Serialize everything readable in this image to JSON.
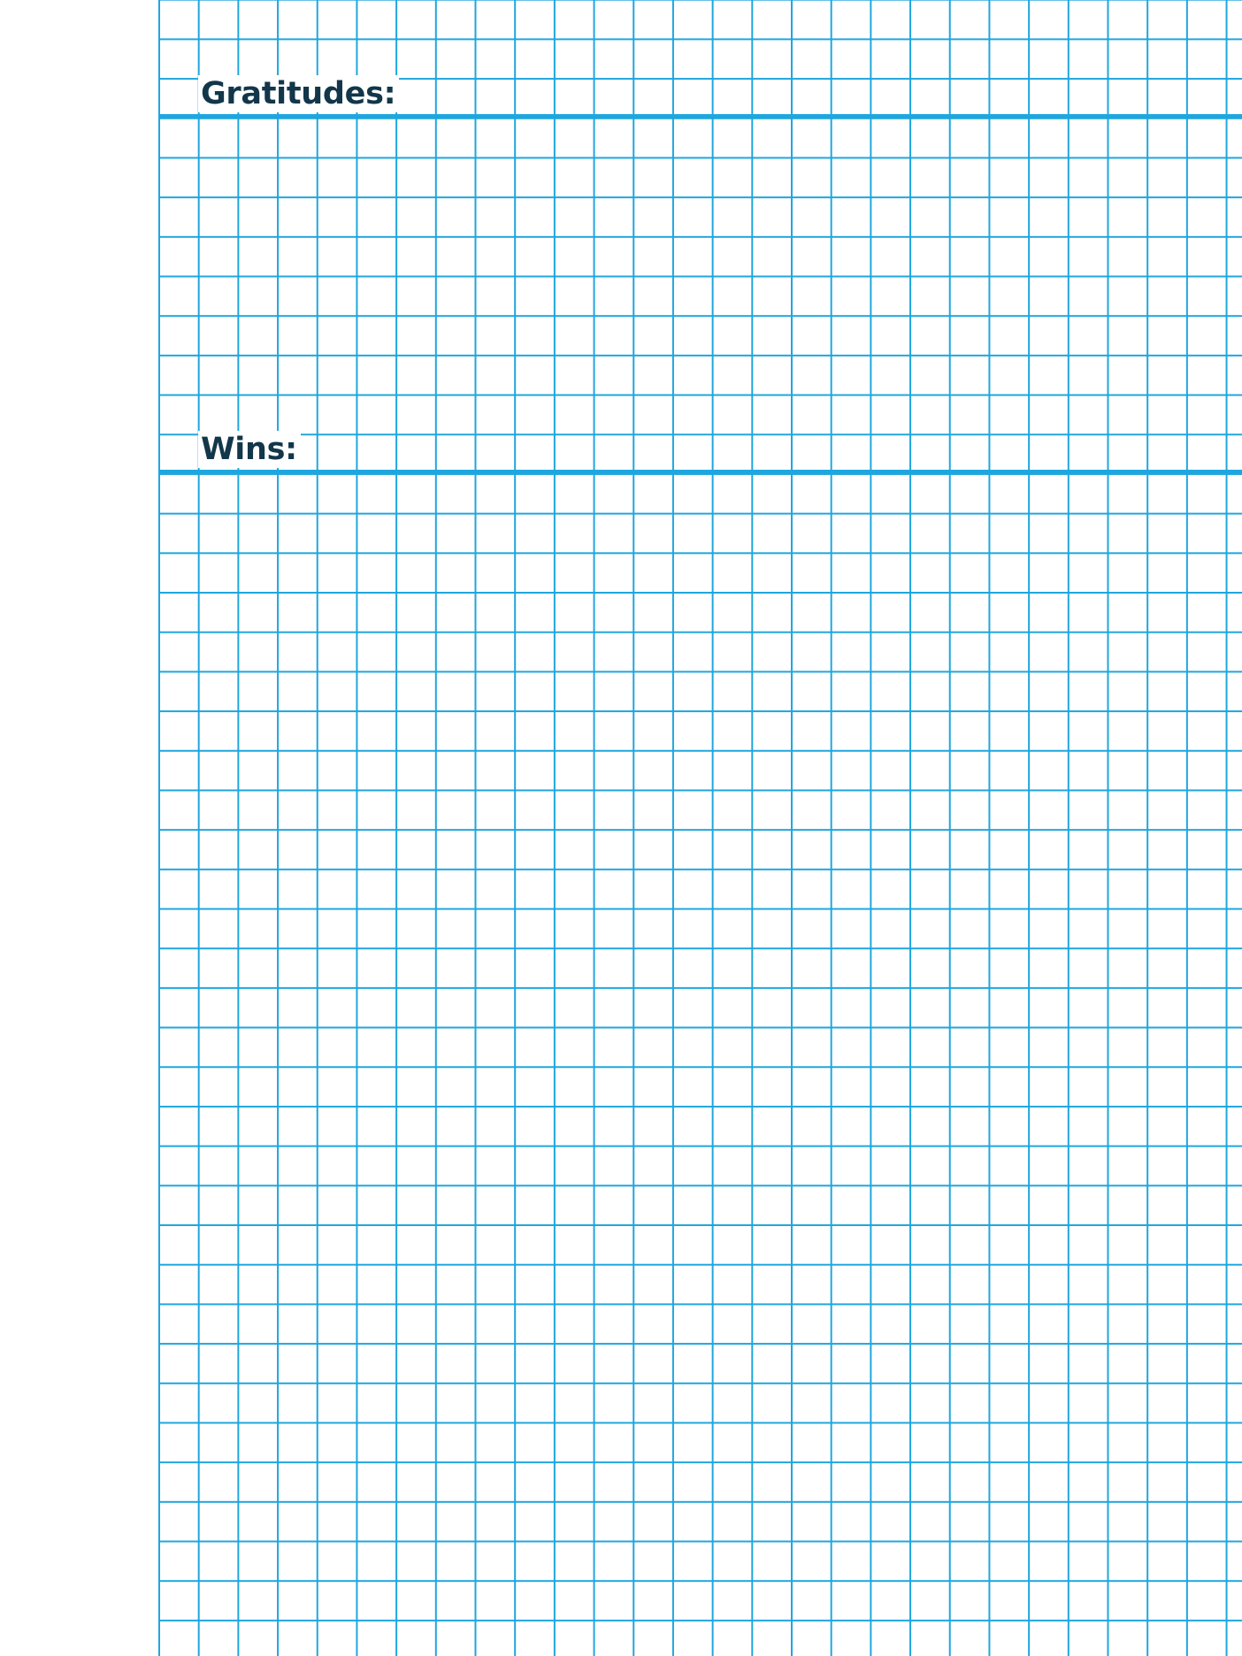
{
  "sections": {
    "gratitudes": {
      "label": "Gratitudes:"
    },
    "wins": {
      "label": "Wins:"
    }
  },
  "colors": {
    "grid_line": "#1ea6de",
    "heading_text": "#12364a",
    "background": "#ffffff"
  }
}
